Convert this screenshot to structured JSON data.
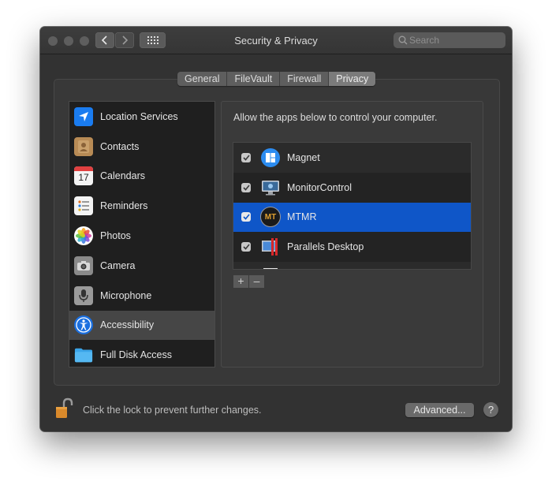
{
  "window": {
    "title": "Security & Privacy"
  },
  "search": {
    "placeholder": "Search"
  },
  "tabs": [
    {
      "label": "General"
    },
    {
      "label": "FileVault"
    },
    {
      "label": "Firewall"
    },
    {
      "label": "Privacy",
      "active": true
    }
  ],
  "sidebar": {
    "items": [
      {
        "label": "Location Services",
        "icon": "location-arrow-icon"
      },
      {
        "label": "Contacts",
        "icon": "contacts-book-icon"
      },
      {
        "label": "Calendars",
        "icon": "calendar-icon",
        "calendar_day": "17"
      },
      {
        "label": "Reminders",
        "icon": "reminders-list-icon"
      },
      {
        "label": "Photos",
        "icon": "photos-flower-icon"
      },
      {
        "label": "Camera",
        "icon": "camera-icon"
      },
      {
        "label": "Microphone",
        "icon": "microphone-icon"
      },
      {
        "label": "Accessibility",
        "icon": "accessibility-icon",
        "selected": true
      },
      {
        "label": "Full Disk Access",
        "icon": "folder-icon"
      }
    ]
  },
  "main": {
    "description": "Allow the apps below to control your computer.",
    "apps": [
      {
        "name": "Magnet",
        "checked": true,
        "icon": "magnet-app-icon"
      },
      {
        "name": "MonitorControl",
        "checked": true,
        "icon": "monitorcontrol-app-icon"
      },
      {
        "name": "MTMR",
        "checked": true,
        "selected": true,
        "icon": "mtmr-app-icon",
        "icon_text": "MT"
      },
      {
        "name": "Parallels Desktop",
        "checked": true,
        "icon": "parallels-app-icon"
      }
    ],
    "add_label": "+",
    "remove_label": "–"
  },
  "footer": {
    "lock_text": "Click the lock to prevent further changes.",
    "advanced_label": "Advanced...",
    "help_label": "?"
  },
  "colors": {
    "selection": "#0f56c8",
    "window_bg": "#323232",
    "lock_orange": "#d9892b"
  }
}
